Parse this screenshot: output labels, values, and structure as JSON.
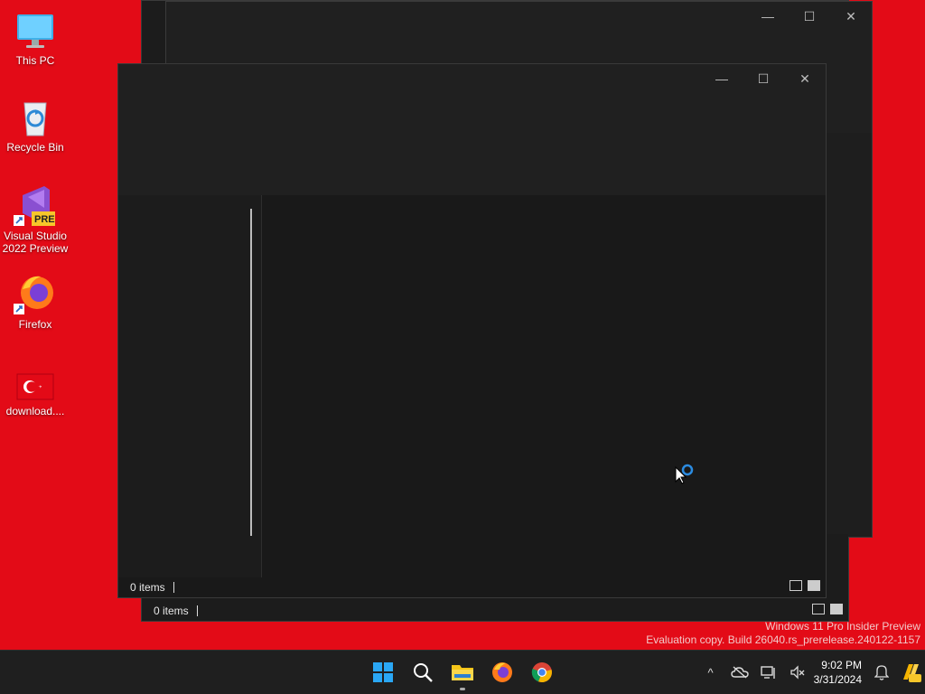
{
  "desktop": {
    "icons": [
      {
        "label": "This PC",
        "icon": "monitor-icon"
      },
      {
        "label": "Recycle Bin",
        "icon": "recycle-bin-icon"
      },
      {
        "label": "Visual Studio 2022 Preview",
        "icon": "visual-studio-icon",
        "badge": "PRE"
      },
      {
        "label": "Firefox",
        "icon": "firefox-icon"
      },
      {
        "label": "download....",
        "icon": "turkey-flag-icon"
      }
    ]
  },
  "windows": {
    "back": {
      "status_count": "0 items"
    },
    "front": {
      "status_count": "0 items"
    },
    "controls": {
      "minimize": "—",
      "maximize": "☐",
      "close": "✕"
    }
  },
  "watermark": {
    "line1": "Windows 11 Pro Insider Preview",
    "line2": "Evaluation copy. Build 26040.rs_prerelease.240122-1157"
  },
  "taskbar": {
    "apps": [
      "start-icon",
      "search-icon",
      "file-explorer-icon",
      "firefox-icon",
      "chrome-icon"
    ],
    "tray": {
      "time": "9:02 PM",
      "date": "3/31/2024",
      "chevron": "^"
    }
  },
  "colors": {
    "desktop_bg": "#e30b17",
    "window_bg": "#1c1c1c",
    "accent": "#0078d4"
  }
}
